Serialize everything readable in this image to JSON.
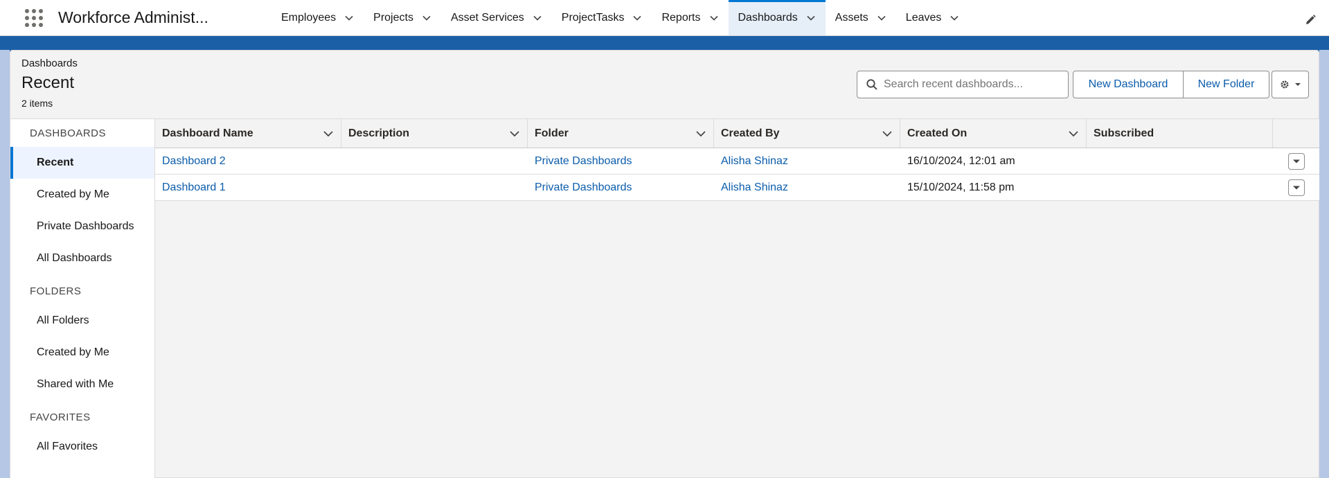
{
  "app": {
    "name": "Workforce Administ..."
  },
  "nav": {
    "tabs": [
      {
        "label": "Employees"
      },
      {
        "label": "Projects"
      },
      {
        "label": "Asset Services"
      },
      {
        "label": "ProjectTasks"
      },
      {
        "label": "Reports"
      },
      {
        "label": "Dashboards",
        "active": true
      },
      {
        "label": "Assets"
      },
      {
        "label": "Leaves"
      }
    ]
  },
  "header": {
    "breadcrumb": "Dashboards",
    "title": "Recent",
    "count": "2 items",
    "search_placeholder": "Search recent dashboards...",
    "new_dashboard": "New Dashboard",
    "new_folder": "New Folder"
  },
  "sidebar": {
    "sections": [
      {
        "title": "DASHBOARDS",
        "items": [
          "Recent",
          "Created by Me",
          "Private Dashboards",
          "All Dashboards"
        ]
      },
      {
        "title": "FOLDERS",
        "items": [
          "All Folders",
          "Created by Me",
          "Shared with Me"
        ]
      },
      {
        "title": "FAVORITES",
        "items": [
          "All Favorites"
        ]
      }
    ],
    "active_item": "Recent"
  },
  "table": {
    "columns": [
      "Dashboard Name",
      "Description",
      "Folder",
      "Created By",
      "Created On",
      "Subscribed"
    ],
    "rows": [
      {
        "name": "Dashboard 2",
        "description": "",
        "folder": "Private Dashboards",
        "created_by": "Alisha Shinaz",
        "created_on": "16/10/2024, 12:01 am",
        "subscribed": ""
      },
      {
        "name": "Dashboard 1",
        "description": "",
        "folder": "Private Dashboards",
        "created_by": "Alisha Shinaz",
        "created_on": "15/10/2024, 11:58 pm",
        "subscribed": ""
      }
    ]
  },
  "colors": {
    "accent": "#0176d3",
    "link": "#0b5cab",
    "band": "#1b5fa6"
  }
}
